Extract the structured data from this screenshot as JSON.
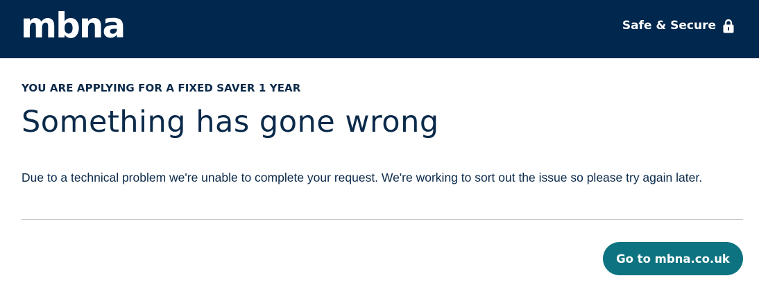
{
  "header": {
    "logo_text": "mbna",
    "secure_label": "Safe & Secure",
    "secure_icon": "lock-icon",
    "background_color": "#00274d"
  },
  "main": {
    "eyebrow": "YOU ARE APPLYING FOR A FIXED SAVER 1 YEAR",
    "title": "Something has gone wrong",
    "message": "Due to a technical problem we're unable to complete your request. We're working to sort out the issue so please try again later."
  },
  "actions": {
    "cta_label": "Go to mbna.co.uk",
    "cta_color": "#0e7380"
  }
}
